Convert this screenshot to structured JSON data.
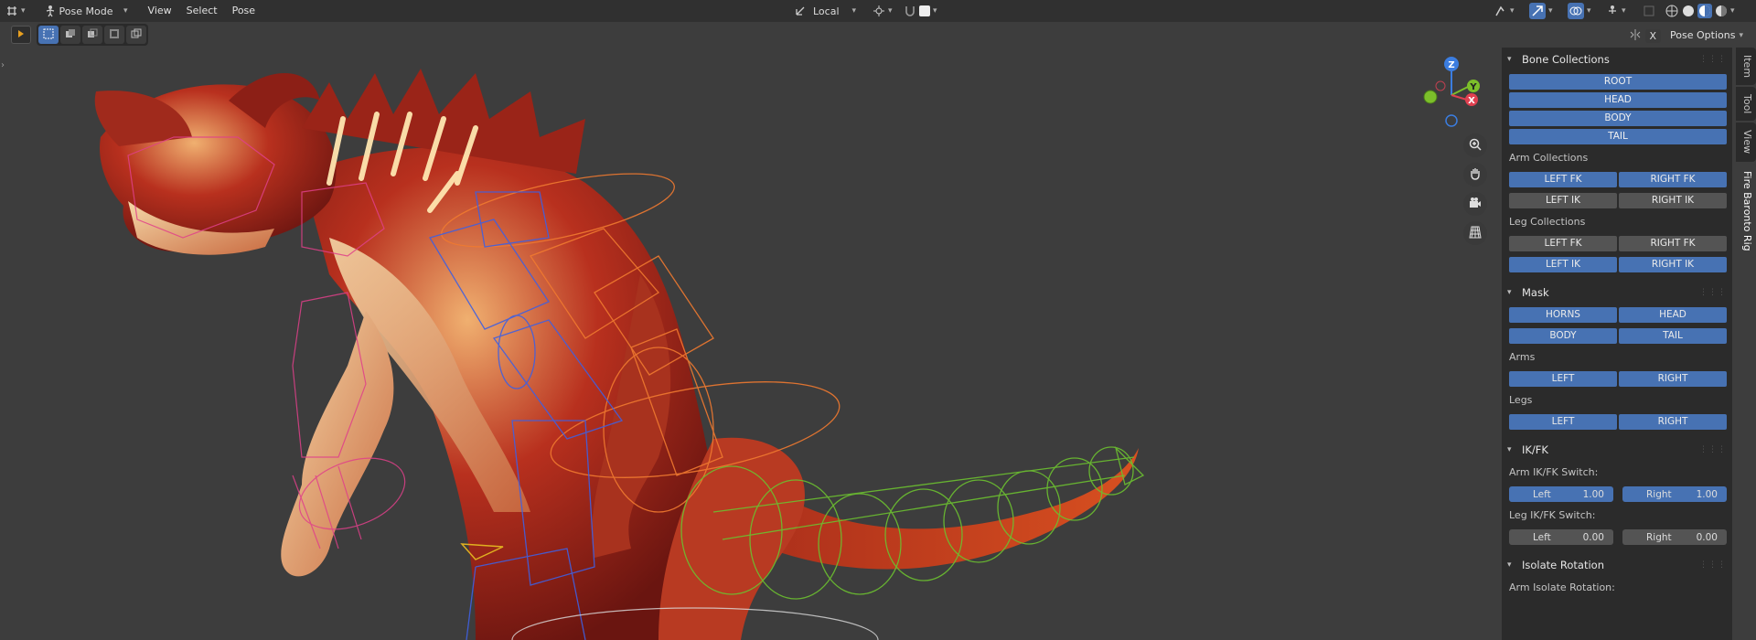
{
  "header": {
    "mode_label": "Pose Mode",
    "menus": [
      "View",
      "Select",
      "Pose"
    ],
    "transform_orientation": "Local",
    "icons": [
      "editor-type-icon",
      "pose-mode-icon",
      "orientation-icon",
      "pivot-icon",
      "snap-icon",
      "proportional-icon",
      "visibility-icon",
      "gizmo-icon",
      "overlay-icon",
      "xray-icon",
      "shading-wire-icon",
      "shading-solid-icon",
      "shading-material-icon",
      "shading-rendered-icon"
    ]
  },
  "tool_options": {
    "x_label": "X",
    "pose_options_label": "Pose Options"
  },
  "gizmo": {
    "z": "Z",
    "y": "Y",
    "x": "X"
  },
  "colors": {
    "accent": "#4772b3",
    "button": "#545454",
    "panel": "#2b2b2b",
    "header": "#303030"
  },
  "sidebar_tabs": [
    "Item",
    "Tool",
    "View",
    "Fire Baronto Rig"
  ],
  "panel": {
    "bone_collections": {
      "title": "Bone Collections",
      "buttons": [
        "ROOT",
        "HEAD",
        "BODY",
        "TAIL"
      ],
      "arm_label": "Arm Collections",
      "arm_fk": [
        "LEFT FK",
        "RIGHT FK"
      ],
      "arm_ik": [
        "LEFT IK",
        "RIGHT IK"
      ],
      "leg_label": "Leg Collections",
      "leg_fk": [
        "LEFT FK",
        "RIGHT FK"
      ],
      "leg_ik": [
        "LEFT IK",
        "RIGHT IK"
      ]
    },
    "mask": {
      "title": "Mask",
      "row1": [
        "HORNS",
        "HEAD"
      ],
      "row2": [
        "BODY",
        "TAIL"
      ],
      "arms_label": "Arms",
      "arms": [
        "LEFT",
        "RIGHT"
      ],
      "legs_label": "Legs",
      "legs": [
        "LEFT",
        "RIGHT"
      ]
    },
    "ikfk": {
      "title": "IK/FK",
      "arm_label": "Arm IK/FK Switch:",
      "arm_left": {
        "label": "Left",
        "value": "1.00"
      },
      "arm_right": {
        "label": "Right",
        "value": "1.00"
      },
      "leg_label": "Leg IK/FK Switch:",
      "leg_left": {
        "label": "Left",
        "value": "0.00"
      },
      "leg_right": {
        "label": "Right",
        "value": "0.00"
      }
    },
    "isolate": {
      "title": "Isolate Rotation",
      "arm_label": "Arm Isolate Rotation:"
    }
  }
}
